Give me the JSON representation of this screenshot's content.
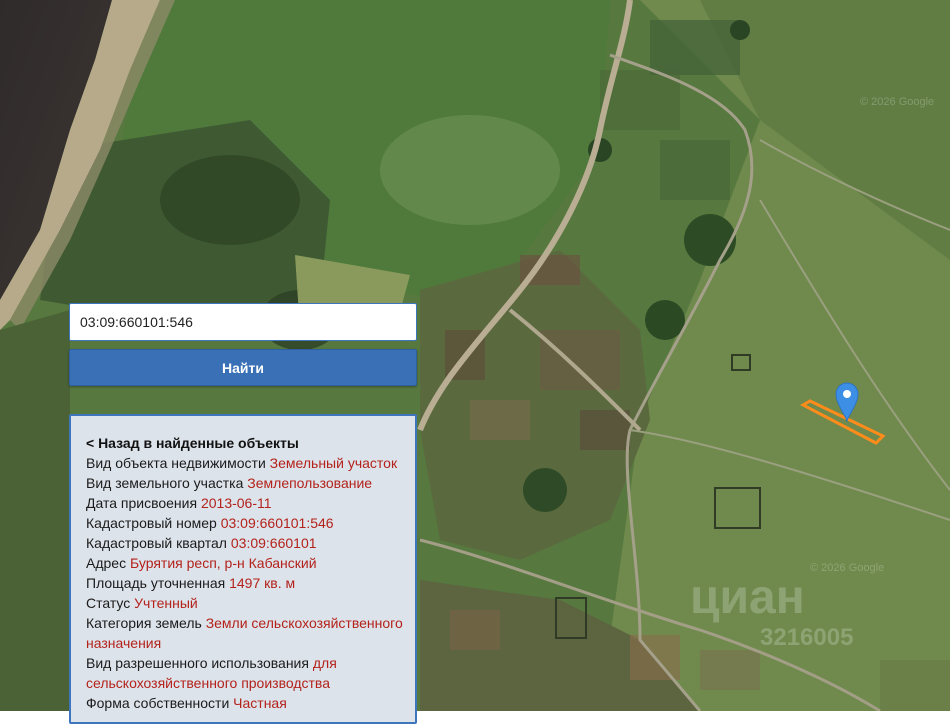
{
  "search": {
    "value": "03:09:660101:546"
  },
  "find_button": {
    "label": "Найти"
  },
  "info": {
    "back_link": "< Назад в найденные объекты",
    "rows": [
      {
        "label": "Вид объекта недвижимости",
        "value": "Земельный участок"
      },
      {
        "label": "Вид земельного участка",
        "value": "Землепользование"
      },
      {
        "label": "Дата присвоения",
        "value": "2013-06-11"
      },
      {
        "label": "Кадастровый номер",
        "value": "03:09:660101:546"
      },
      {
        "label": "Кадастровый квартал",
        "value": "03:09:660101"
      },
      {
        "label": "Адрес",
        "value": "Бурятия респ, р-н Кабанский"
      },
      {
        "label": "Площадь уточненная",
        "value": "1497 кв. м"
      },
      {
        "label": "Статус",
        "value": "Учтенный"
      },
      {
        "label": "Категория земель",
        "value": "Земли сельскохозяйственного назначения"
      },
      {
        "label": "Вид разрешенного использования",
        "value": "для сельскохозяйственного производства"
      },
      {
        "label": "Форма собственности",
        "value": "Частная"
      }
    ]
  },
  "watermarks": {
    "brand": "циан",
    "id": "3216005",
    "copyright": "© 2026 Google"
  },
  "colors": {
    "accent": "#3a70b5",
    "value_text": "#b3221b",
    "parcel_outline": "#ff8c1a",
    "marker": "#3d8fe6"
  }
}
